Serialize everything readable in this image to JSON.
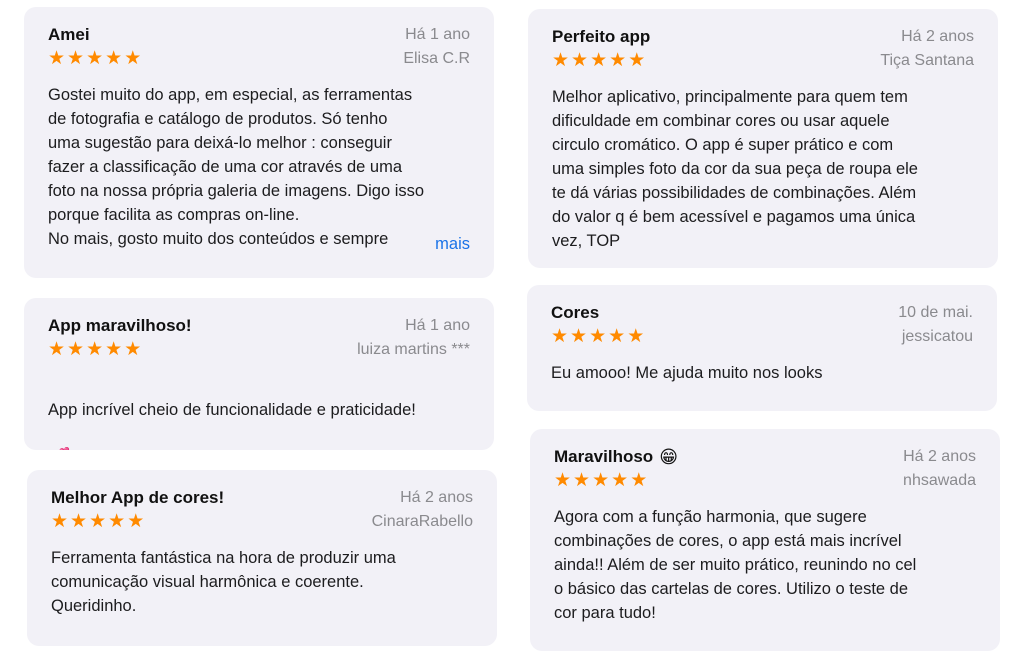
{
  "reviews": [
    {
      "title": "Amei",
      "date": "Há 1 ano",
      "author": "Elisa C.R",
      "rating": 5,
      "body": "Gostei muito do app, em especial, as ferramentas\nde fotografia e catálogo de produtos. Só tenho\numa sugestão para deixá-lo melhor : conseguir\nfazer a classificação de uma cor através de uma\nfoto na nossa própria galeria de imagens. Digo isso\nporque facilita as compras on-line.\nNo mais, gosto muito dos conteúdos e sempre",
      "more_label": "mais"
    },
    {
      "title": "App maravilhoso!",
      "date": "Há 1 ano",
      "author": "luiza martins ***",
      "rating": 5,
      "body": "App incrível cheio de funcionalidade e praticidade!",
      "emoji": "💕"
    },
    {
      "title": "Melhor App de cores!",
      "date": "Há 2 anos",
      "author": "CinaraRabello",
      "rating": 5,
      "body": "Ferramenta fantástica na hora de produzir uma\ncomunicação visual harmônica e coerente.\nQueridinho."
    },
    {
      "title": "Perfeito app",
      "date": "Há 2 anos",
      "author": "Tiça Santana",
      "rating": 5,
      "body": "Melhor aplicativo, principalmente para quem tem\ndificuldade em combinar cores ou usar aquele\ncirculo cromático.  O app é super prático e com\numa simples foto da cor  da sua peça de roupa ele\nte dá várias possibilidades de combinações. Além\ndo valor q é bem acessível e pagamos uma única\nvez, TOP"
    },
    {
      "title": "Cores",
      "date": "10 de mai.",
      "author": "jessicatou",
      "rating": 5,
      "body": "Eu amooo! Me ajuda muito nos looks"
    },
    {
      "title": "Maravilhoso",
      "title_emoji": "😁",
      "date": "Há 2 anos",
      "author": "nhsawada",
      "rating": 5,
      "body": "Agora com a função harmonia, que sugere\ncombinações de cores, o app está mais incrível\nainda!! Além de ser muito prático, reunindo no cel\no básico das cartelas de cores. Utilizo o teste de\ncor para tudo!"
    }
  ],
  "colors": {
    "card_bg": "#f2f1f7",
    "star": "#ff8a00",
    "meta": "#8a8a8e",
    "link": "#1a73e8"
  },
  "icons": {
    "star": "star-icon"
  }
}
